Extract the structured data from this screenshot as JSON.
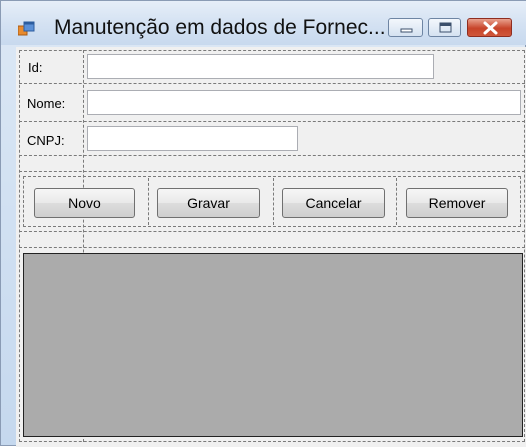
{
  "window": {
    "title": "Manutenção em dados de Fornec...",
    "controls": {
      "minimize": "minimize-icon",
      "maximize": "maximize-icon",
      "close": "close-icon"
    }
  },
  "form": {
    "fields": [
      {
        "label": "Id:",
        "value": ""
      },
      {
        "label": "Nome:",
        "value": ""
      },
      {
        "label": "CNPJ:",
        "value": ""
      }
    ],
    "buttons": {
      "novo": "Novo",
      "gravar": "Gravar",
      "cancelar": "Cancelar",
      "remover": "Remover"
    }
  },
  "colors": {
    "grid_background": "#ababab",
    "close_button": "#c7442a",
    "form_background": "#f0f0f0"
  }
}
